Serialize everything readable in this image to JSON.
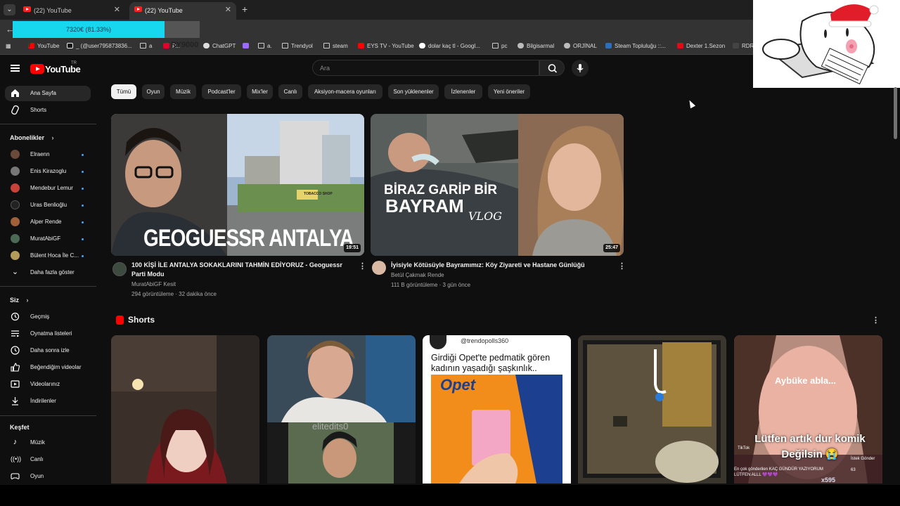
{
  "browser": {
    "tabs": [
      {
        "title": "(22) YouTube",
        "active": false
      },
      {
        "title": "(22) YouTube",
        "active": true
      }
    ],
    "tab_tooltip": "",
    "overlay_progress": {
      "text": "7320€ (81.33%)",
      "fraction": 0.8133,
      "color": "#17d7ef"
    },
    "try_text": "TRY",
    "ry_text": "RY9000",
    "bookmarks": [
      {
        "label": "YouTube",
        "icon": "youtube-icon"
      },
      {
        "label": "_ (@user795873836...",
        "icon": "tiktok-icon"
      },
      {
        "label": "a",
        "icon": "folder-icon"
      },
      {
        "label": "P...",
        "icon": "bookmark-icon"
      },
      {
        "label": "ChatGPT",
        "icon": "chatgpt-icon"
      },
      {
        "label": "",
        "icon": "feather-icon"
      },
      {
        "label": "a.",
        "icon": "folder-icon"
      },
      {
        "label": "Trendyol",
        "icon": "folder-icon"
      },
      {
        "label": "steam",
        "icon": "folder-icon"
      },
      {
        "label": "EYS TV - YouTube",
        "icon": "youtube-icon"
      },
      {
        "label": "dolar kaç tl - Googl...",
        "icon": "google-icon"
      },
      {
        "label": "pc",
        "icon": "folder-icon"
      },
      {
        "label": "Bilgisarmal",
        "icon": "globe-icon"
      },
      {
        "label": "ORJİNAL",
        "icon": "globe-icon"
      },
      {
        "label": "Steam Topluluğu ::...",
        "icon": "steam-icon"
      },
      {
        "label": "Dexter 1.Sezon",
        "icon": "bookmark-icon"
      },
      {
        "label": "RDR",
        "icon": "bookmark-icon"
      }
    ]
  },
  "youtube": {
    "logo_text": "YouTube",
    "logo_region": "TR",
    "search_placeholder": "Ara",
    "chips": [
      "Tümü",
      "Oyun",
      "Müzik",
      "Podcast'ler",
      "Mix'ler",
      "Canlı",
      "Aksiyon-macera oyunları",
      "Son yüklenenler",
      "İzlenenler",
      "Yeni öneriler"
    ],
    "sidebar": {
      "main": [
        {
          "label": "Ana Sayfa",
          "icon": "home-icon"
        },
        {
          "label": "Shorts",
          "icon": "shorts-icon"
        }
      ],
      "subscriptions_title": "Abonelikler",
      "subscriptions": [
        "Elraenn",
        "Enis Kirazoglu",
        "Mendebur Lemur",
        "Uras Benlioğlu",
        "Alper Rende",
        "MuratAbiGF",
        "Bülent Hoca İle C..."
      ],
      "show_more": "Daha fazla göster",
      "you_title": "Siz",
      "you": [
        {
          "label": "Geçmiş",
          "icon": "history-icon"
        },
        {
          "label": "Oynatma listeleri",
          "icon": "playlist-icon"
        },
        {
          "label": "Daha sonra izle",
          "icon": "clock-icon"
        },
        {
          "label": "Beğendiğim videolar",
          "icon": "like-icon"
        },
        {
          "label": "Videolarınız",
          "icon": "video-icon"
        },
        {
          "label": "İndirilenler",
          "icon": "download-icon"
        }
      ],
      "explore_title": "Keşfet",
      "explore": [
        {
          "label": "Müzik",
          "icon": "music-icon"
        },
        {
          "label": "Canlı",
          "icon": "live-icon"
        },
        {
          "label": "Oyun",
          "icon": "game-icon"
        }
      ]
    },
    "videos": [
      {
        "title": "100 KİŞİ İLE ANTALYA SOKAKLARINI TAHMİN EDİYORUZ - Geoguessr Parti Modu",
        "channel": "MuratAbiGF Kesit",
        "stats": "294 görüntüleme · 32 dakika önce",
        "duration": "19:51",
        "thumb_text": "GEOGUESSR ANTALYA",
        "shop_sign": "TOBACCO SHOP"
      },
      {
        "title": "İyisiyle Kötüsüyle Bayramımız: Köy Ziyareti ve Hastane Günlüğü",
        "channel": "Betül Çakmak Rende",
        "stats": "111 B görüntüleme · 3 gün önce",
        "duration": "25:47",
        "thumb_text_line1": "BİRAZ GARİP BİR",
        "thumb_text_line2": "BAYRAM",
        "thumb_text_script": "VLOG"
      }
    ],
    "shorts_title": "Shorts",
    "shorts": [
      {
        "overlay": ""
      },
      {
        "overlay": "elitedits0"
      },
      {
        "handle": "@trendopolls360",
        "caption": "Girdiği Opet'te pedmatik gören kadının yaşadığı şaşkınlık..",
        "brand": "Opet"
      },
      {
        "overlay": ""
      },
      {
        "top_text": "Aybüke abla...",
        "middle_text": "Lütfen artık dur komik Değilsin 😭",
        "tiktok": "TikTok",
        "request": "İstek Gönder",
        "bottom_text": "En çok gönderilen KAÇ GÜNDÜR YAZIYORUM LÜTFEN ALLL 💜💜💜",
        "count": "x595",
        "viewers": "63"
      }
    ]
  }
}
